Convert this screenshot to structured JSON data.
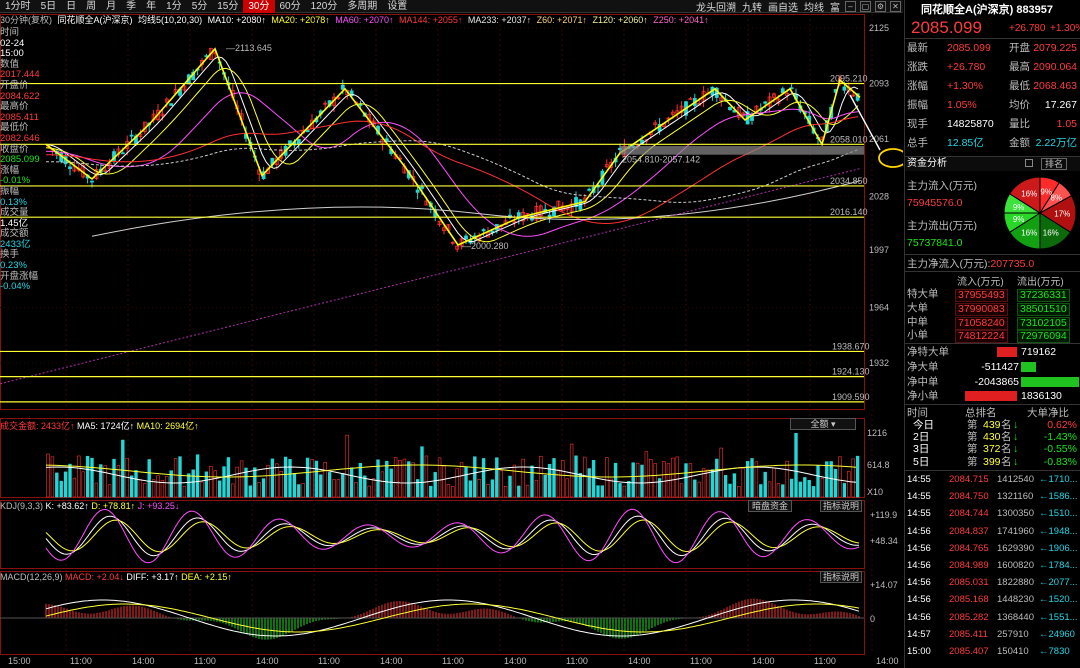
{
  "toolbar": {
    "tabs": [
      "1分时",
      "5日",
      "日",
      "周",
      "月",
      "季",
      "年",
      "1分",
      "5分",
      "15分",
      "30分",
      "60分",
      "120分",
      "多周期",
      "设置"
    ],
    "active_tab": "30分",
    "tools": [
      "龙头回溯",
      "九转",
      "画自选",
      "均线",
      "富"
    ]
  },
  "legend": {
    "period": "30分钟(复权)",
    "name": "同花顺全A(沪深京)",
    "ma_group": "均线5(10,20,30)",
    "ma10": "MA10: +2080↑",
    "ma20": "MA20: +2078↑",
    "ma60": "MA60: +2070↑",
    "ma144": "MA144: +2055↑",
    "ma233": "MA233: +2037↑",
    "z60": "Z60: +2071↑",
    "z120": "Z120: +2060↑",
    "z250": "Z250: +2041↑"
  },
  "left_info": {
    "time_label": "时间",
    "date": "02-24",
    "time": "15:00",
    "value_label": "数值",
    "value": "2017.444",
    "open_label": "开盘价",
    "open": "2084.622",
    "high_label": "最高价",
    "high": "2085.411",
    "low_label": "最低价",
    "low": "2082.646",
    "close_label": "收盘价",
    "close": "2085.099",
    "chg_label": "涨幅",
    "chg": "-0.01%",
    "amp_label": "振幅",
    "amp": "0.13%",
    "vol_label": "成交量",
    "vol": "1.45亿",
    "amt_label": "成交额",
    "amt": "2433亿",
    "turn_label": "换手",
    "turn": "0.23%",
    "open_chg_label": "开盘涨幅",
    "open_chg": "-0.04%"
  },
  "price_axis": [
    "2125",
    "2093",
    "2061",
    "2028",
    "1997",
    "1964",
    "1932"
  ],
  "annotations": {
    "peak": "2113.645",
    "trough": "2000.280",
    "mid_range": "2054.810-2057.142",
    "level_2095": "2095.210",
    "level_2058": "2058.010",
    "level_2034": "2034.850",
    "level_2016": "2016.140",
    "level_1938": "1938.670",
    "level_1924": "1924.130",
    "level_1909": "1909.590"
  },
  "volume_panel": {
    "legend_amt": "成交金额: 2433亿↑",
    "legend_ma5": "MA5: 1724亿↑",
    "legend_ma10": "MA10: 2694亿↑",
    "dropdown": "全额",
    "axis_top": "1216",
    "axis_mid": "614.8",
    "axis_unit": "X10"
  },
  "kdj_panel": {
    "legend_name": "KDJ(9,3,3)",
    "k": "K: +83.62↑",
    "d": "D: +78.81↑",
    "j": "J: +93.25↓",
    "btn1": "暗盘资金",
    "btn2": "指标说明",
    "axis_top": "+119.9",
    "axis_mid": "+48.34"
  },
  "macd_panel": {
    "legend_name": "MACD(12,26,9)",
    "macd": "MACD: +2.04↓",
    "diff": "DIFF: +3.17↑",
    "dea": "DEA: +2.15↑",
    "btn": "指标说明",
    "axis_top": "+14.07",
    "axis_zero": "0"
  },
  "time_axis": [
    "15:00",
    "11:00",
    "14:00",
    "11:00",
    "14:00",
    "11:00",
    "14:00",
    "11:00",
    "14:00",
    "11:00",
    "14:00",
    "11:00",
    "14:00",
    "11:00",
    "14:00"
  ],
  "quote": {
    "title": "同花顺全A(沪深京) 883957",
    "price": "2085.099",
    "change": "+26.780",
    "pct": "+1.30%",
    "rows": [
      {
        "l1": "最新",
        "v1": "2085.099",
        "l2": "开盘",
        "v2": "2079.225"
      },
      {
        "l1": "涨跌",
        "v1": "+26.780",
        "l2": "最高",
        "v2": "2090.064"
      },
      {
        "l1": "涨幅",
        "v1": "+1.30%",
        "l2": "最低",
        "v2": "2068.463"
      },
      {
        "l1": "振幅",
        "v1": "1.05%",
        "l2": "均价",
        "v2": "17.267"
      },
      {
        "l1": "现手",
        "v1": "14825870",
        "l2": "量比",
        "v2": "1.05"
      },
      {
        "l1": "总手",
        "v1": "12.85亿",
        "l2": "金额",
        "v2": "2.22万亿"
      }
    ]
  },
  "funds": {
    "tab": "资金分析",
    "rank_btn": "排名",
    "inflow_label": "主力流入(万元)",
    "inflow": "75945576.0",
    "outflow_label": "主力流出(万元)",
    "outflow": "75737841.0",
    "pie": [
      {
        "label": "9%",
        "pct": 9,
        "color": "#ff2b2b"
      },
      {
        "label": "8%",
        "pct": 8,
        "color": "#ff5050"
      },
      {
        "label": "17%",
        "pct": 17,
        "color": "#b01010"
      },
      {
        "label": "16%",
        "pct": 16,
        "color": "#0b6b0b"
      },
      {
        "label": "16%",
        "pct": 16,
        "color": "#12a012"
      },
      {
        "label": "9%",
        "pct": 9,
        "color": "#27d827"
      },
      {
        "label": "9%",
        "pct": 9,
        "color": "#3be33b"
      },
      {
        "label": "16%",
        "pct": 16,
        "color": "#cc1a1a"
      }
    ],
    "net_label": "主力净流入(万元):",
    "net": "207735.0",
    "table_h1": "流入(万元)",
    "table_h2": "流出(万元)",
    "table": [
      {
        "name": "特大单",
        "in": "37955493",
        "out": "37236331"
      },
      {
        "name": "大单",
        "in": "37990083",
        "out": "38501510"
      },
      {
        "name": "中单",
        "in": "71058240",
        "out": "73102105"
      },
      {
        "name": "小单",
        "in": "74812224",
        "out": "72976094"
      }
    ],
    "net_rows": [
      {
        "name": "净特大单",
        "value": "719162",
        "sign": 1,
        "frac": 0.35
      },
      {
        "name": "净大单",
        "value": "-511427",
        "sign": -1,
        "frac": 0.25
      },
      {
        "name": "净中单",
        "value": "-2043865",
        "sign": -1,
        "frac": 1.0
      },
      {
        "name": "净小单",
        "value": "1836130",
        "sign": 1,
        "frac": 0.9
      }
    ]
  },
  "rank": {
    "h1": "时间",
    "h2": "总排名",
    "h3": "大单净比",
    "rows": [
      {
        "t": "今日",
        "pre": "第",
        "n": "439",
        "suf": "名",
        "dir": "↓",
        "pct": "0.62%"
      },
      {
        "t": "2日",
        "pre": "第",
        "n": "430",
        "suf": "名",
        "dir": "↓",
        "pct": "-1.43%"
      },
      {
        "t": "3日",
        "pre": "第",
        "n": "372",
        "suf": "名",
        "dir": "↓",
        "pct": "-0.55%"
      },
      {
        "t": "5日",
        "pre": "第",
        "n": "399",
        "suf": "名",
        "dir": "↓",
        "pct": "-0.83%"
      }
    ]
  },
  "ticks": [
    {
      "t": "14:55",
      "p": "2084.715",
      "v": "1412540",
      "s": "←1710..."
    },
    {
      "t": "14:55",
      "p": "2084.750",
      "v": "1321160",
      "s": "←1586..."
    },
    {
      "t": "14:55",
      "p": "2084.744",
      "v": "1300350",
      "s": "←1510..."
    },
    {
      "t": "14:56",
      "p": "2084.837",
      "v": "1741960",
      "s": "←1948..."
    },
    {
      "t": "14:56",
      "p": "2084.765",
      "v": "1629390",
      "s": "←1906..."
    },
    {
      "t": "14:56",
      "p": "2084.989",
      "v": "1600820",
      "s": "←1784..."
    },
    {
      "t": "14:56",
      "p": "2085.031",
      "v": "1822880",
      "s": "←2077..."
    },
    {
      "t": "14:56",
      "p": "2085.168",
      "v": "1448230",
      "s": "←1520..."
    },
    {
      "t": "14:56",
      "p": "2085.282",
      "v": "1368440",
      "s": "←1551..."
    },
    {
      "t": "14:57",
      "p": "2085.411",
      "v": "257910",
      "s": "←24960"
    },
    {
      "t": "15:00",
      "p": "2085.407",
      "v": "150410",
      "s": "←7830"
    }
  ]
}
